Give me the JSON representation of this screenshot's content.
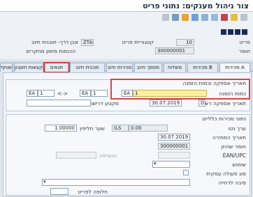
{
  "window": {
    "title": "צור ניהול מענקים: נתוני פריט"
  },
  "header": {
    "item_label": "פריט",
    "item_value": "10",
    "category_label": "קטגוריית פריט",
    "category_value": "ZTAO",
    "category_desc": "אבן דרך- תוכנית חיוב",
    "material_label": "חומר",
    "material_value": "300000001",
    "material_desc": "הכנסות מימון מחקרים"
  },
  "tabs": [
    {
      "label": "מכירות A"
    },
    {
      "label": "מכירות B"
    },
    {
      "label": "משלוח"
    },
    {
      "label": "מסמך חיוב"
    },
    {
      "label": "מכירות חיוב"
    },
    {
      "label": "תוכנית חיוב"
    },
    {
      "label": "תנאים"
    },
    {
      "label": "הקצאות חשבון"
    },
    {
      "label": "שותף"
    }
  ],
  "quantity_group": {
    "title": "תאריך אספקה וכמות הזמנה",
    "order_qty_label": "כמות הזמנה",
    "order_qty_unit": "EA",
    "order_qty_value": "1",
    "conv_left_unit": "EA",
    "conv_left_value": "1",
    "conv_arrow": "<->",
    "conv_right_unit": "EA",
    "conv_right_value": "1",
    "first_date_label": "תאריך אספקה ראשון",
    "first_date_prefix": "D",
    "first_date_value": "30.07.2019",
    "req_segment_label": "מקטע דרישות"
  },
  "general_group": {
    "title": "נתוני מכירות כלליים",
    "net_value_label": "ערך נטו",
    "net_value": "0.00",
    "currency": "ILS",
    "exchange_rate_label": "שער חליפין",
    "exchange_rate_value": "1.00000",
    "pricing_date_label": "תאריך המחירה",
    "pricing_date_value": "30.07.2019",
    "material_entered_label": "חומר שהוזן",
    "material_entered_value": "300000001",
    "ean_label": "EAN/UPC",
    "reference_label": "הועדפה",
    "usage_label": "שימוש",
    "business_label": "סוג פעולה עסקית",
    "reject_label": "סיבה לדחייה",
    "item_sub_label": "חלופה לפריט"
  }
}
